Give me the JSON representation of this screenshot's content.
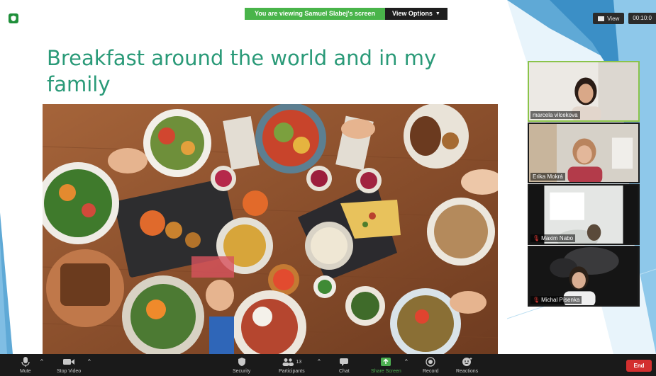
{
  "screen_share": {
    "banner": "You are viewing Samuel Slabej's screen",
    "view_options": "View Options"
  },
  "top_right": {
    "view_label": "View",
    "timer": "00:10:0"
  },
  "slide": {
    "title": "Breakfast around the world and in my family",
    "accent_color": "#2a9a78",
    "photo_description_icon": "food-table-photo"
  },
  "participants": [
    {
      "name": "marcela vilcekova",
      "muted": false,
      "active": true
    },
    {
      "name": "Erika Mokrá",
      "muted": false,
      "active": false
    },
    {
      "name": "Maxim Nabo",
      "muted": true,
      "active": false
    },
    {
      "name": "Michal Písenka",
      "muted": true,
      "active": false
    }
  ],
  "toolbar": {
    "mute": "Mute",
    "stop_video": "Stop Video",
    "security": "Security",
    "participants": "Participants",
    "participants_count": "13",
    "chat": "Chat",
    "share_screen": "Share Screen",
    "record": "Record",
    "reactions": "Reactions",
    "end": "End"
  },
  "colors": {
    "toolbar_bg": "#1a1a1a",
    "share_green": "#4caf50",
    "end_red": "#d32f2f",
    "banner_green": "#49b44a"
  }
}
